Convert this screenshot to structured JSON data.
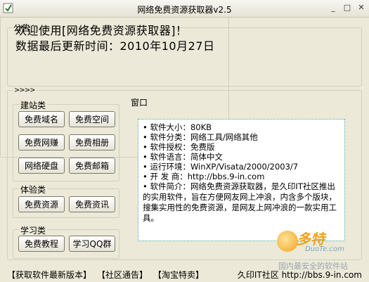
{
  "window": {
    "title": "网络免费资源获取器v2.5",
    "minimize": "_",
    "maximize": "□",
    "close": "✕"
  },
  "notice": {
    "legend": "公告",
    "line1": "欢迎使用[网络免费资源获取器]！",
    "line2": "数据最后更新时间：2010年10月27日"
  },
  "main": {
    "arrows": ">>>>"
  },
  "groups": {
    "build": {
      "label": "建站类",
      "buttons": [
        "免费域名",
        "免费空间",
        "免费网赚",
        "免费相册",
        "网络硬盘",
        "免费邮箱"
      ]
    },
    "experience": {
      "label": "体验类",
      "buttons": [
        "免费资源",
        "免费资讯"
      ]
    },
    "study": {
      "label": "学习类",
      "buttons": [
        "免费教程",
        "学习QQ群"
      ]
    }
  },
  "window_panel": {
    "label": "窗口",
    "lines": [
      "• 软件大小：80KB",
      "• 软件分类：网络工具/网络其他",
      "• 软件授权：免费版",
      "• 软件语言：简体中文",
      "• 运行环境：WinXP/Visata/2000/2003/7",
      "• 开 发 商：http://bbs.9-in.com"
    ],
    "intro": "• 软件简介：网络免费资源获取器，是久印IT社区推出的实用软件，旨在方便网友网上冲浪，内含多个版块，搜集实用性的免费资源，是网友上网冲浪的一款实用工具。"
  },
  "footer": {
    "link1": "【获取软件最新版本】",
    "link2": "【社区通告】",
    "link3": "【淘宝特卖】",
    "site": "久印IT社区 http://bbs.9-in.com"
  },
  "watermark": {
    "logo": "多特",
    "sub": "DuoTe.com",
    "caption": "国内最安全的软件站"
  },
  "colors": {
    "background": "#ece9d8",
    "info_border": "#39a39a",
    "watermark_orange": "#f0a21e"
  }
}
